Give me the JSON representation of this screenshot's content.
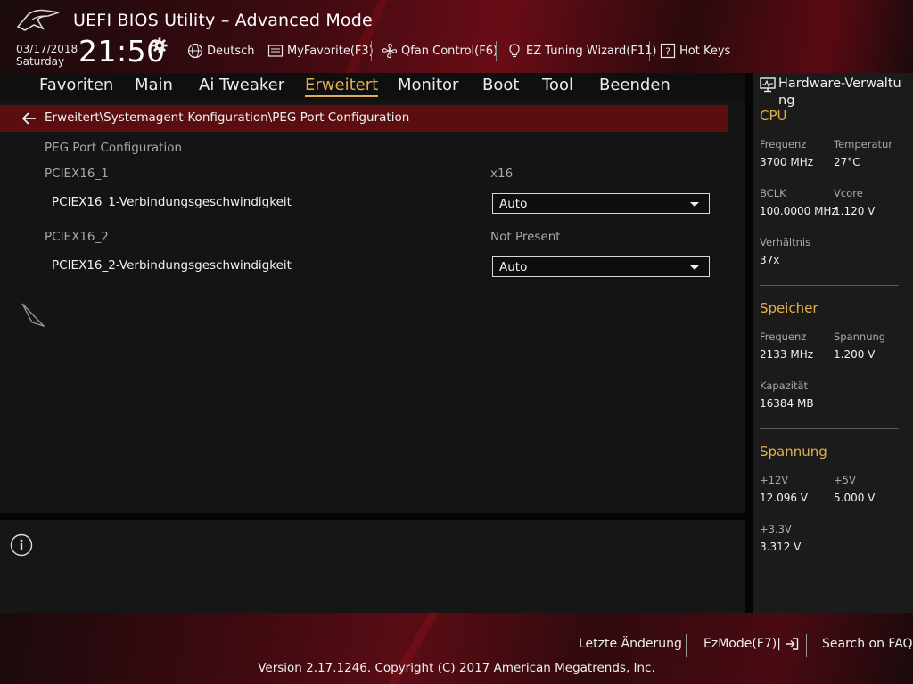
{
  "header": {
    "title": "UEFI BIOS Utility – Advanced Mode",
    "date": "03/17/2018",
    "day": "Saturday",
    "time": "21:50",
    "items": [
      {
        "label": "Deutsch",
        "icon": "globe-icon"
      },
      {
        "label": "MyFavorite(F3)",
        "icon": "favorite-list-icon"
      },
      {
        "label": "Qfan Control(F6)",
        "icon": "fan-icon"
      },
      {
        "label": "EZ Tuning Wizard(F11)",
        "icon": "lightbulb-icon"
      },
      {
        "label": "Hot Keys",
        "icon": "question-box-icon"
      }
    ]
  },
  "menu": {
    "tabs": [
      {
        "label": "Favoriten"
      },
      {
        "label": "Main"
      },
      {
        "label": "Ai Tweaker"
      },
      {
        "label": "Erweitert",
        "active": true
      },
      {
        "label": "Monitor"
      },
      {
        "label": "Boot"
      },
      {
        "label": "Tool"
      },
      {
        "label": "Beenden"
      }
    ]
  },
  "breadcrumb": "Erweitert\\Systemagent-Konfiguration\\PEG Port Configuration",
  "content": {
    "section_title": "PEG Port Configuration",
    "ports": [
      {
        "name": "PCIEX16_1",
        "status": "x16",
        "setting_label": "PCIEX16_1-Verbindungsgeschwindigkeit",
        "setting_value": "Auto"
      },
      {
        "name": "PCIEX16_2",
        "status": "Not Present",
        "setting_label": "PCIEX16_2-Verbindungsgeschwindigkeit",
        "setting_value": "Auto"
      }
    ]
  },
  "hardware": {
    "title": "Hardware-Verwaltung",
    "cpu": {
      "heading": "CPU",
      "freq_label": "Frequenz",
      "freq": "3700 MHz",
      "temp_label": "Temperatur",
      "temp": "27°C",
      "bclk_label": "BCLK",
      "bclk": "100.0000 MHz",
      "vcore_label": "Vcore",
      "vcore": "1.120 V",
      "ratio_label": "Verhältnis",
      "ratio": "37x"
    },
    "memory": {
      "heading": "Speicher",
      "freq_label": "Frequenz",
      "freq": "2133 MHz",
      "volt_label": "Spannung",
      "volt": "1.200 V",
      "cap_label": "Kapazität",
      "cap": "16384 MB"
    },
    "voltage": {
      "heading": "Spannung",
      "v12_label": "+12V",
      "v12": "12.096 V",
      "v5_label": "+5V",
      "v5": "5.000 V",
      "v33_label": "+3.3V",
      "v33": "3.312 V"
    }
  },
  "footer": {
    "last_change": "Letzte Änderung",
    "ezmode": "EzMode(F7)|",
    "faq": "Search on FAQ",
    "copyright": "Version 2.17.1246. Copyright (C) 2017 American Megatrends, Inc."
  },
  "colors": {
    "accent": "#e2b04a",
    "breadcrumb_bg": "#5a0e10",
    "panel_bg": "#141414"
  }
}
